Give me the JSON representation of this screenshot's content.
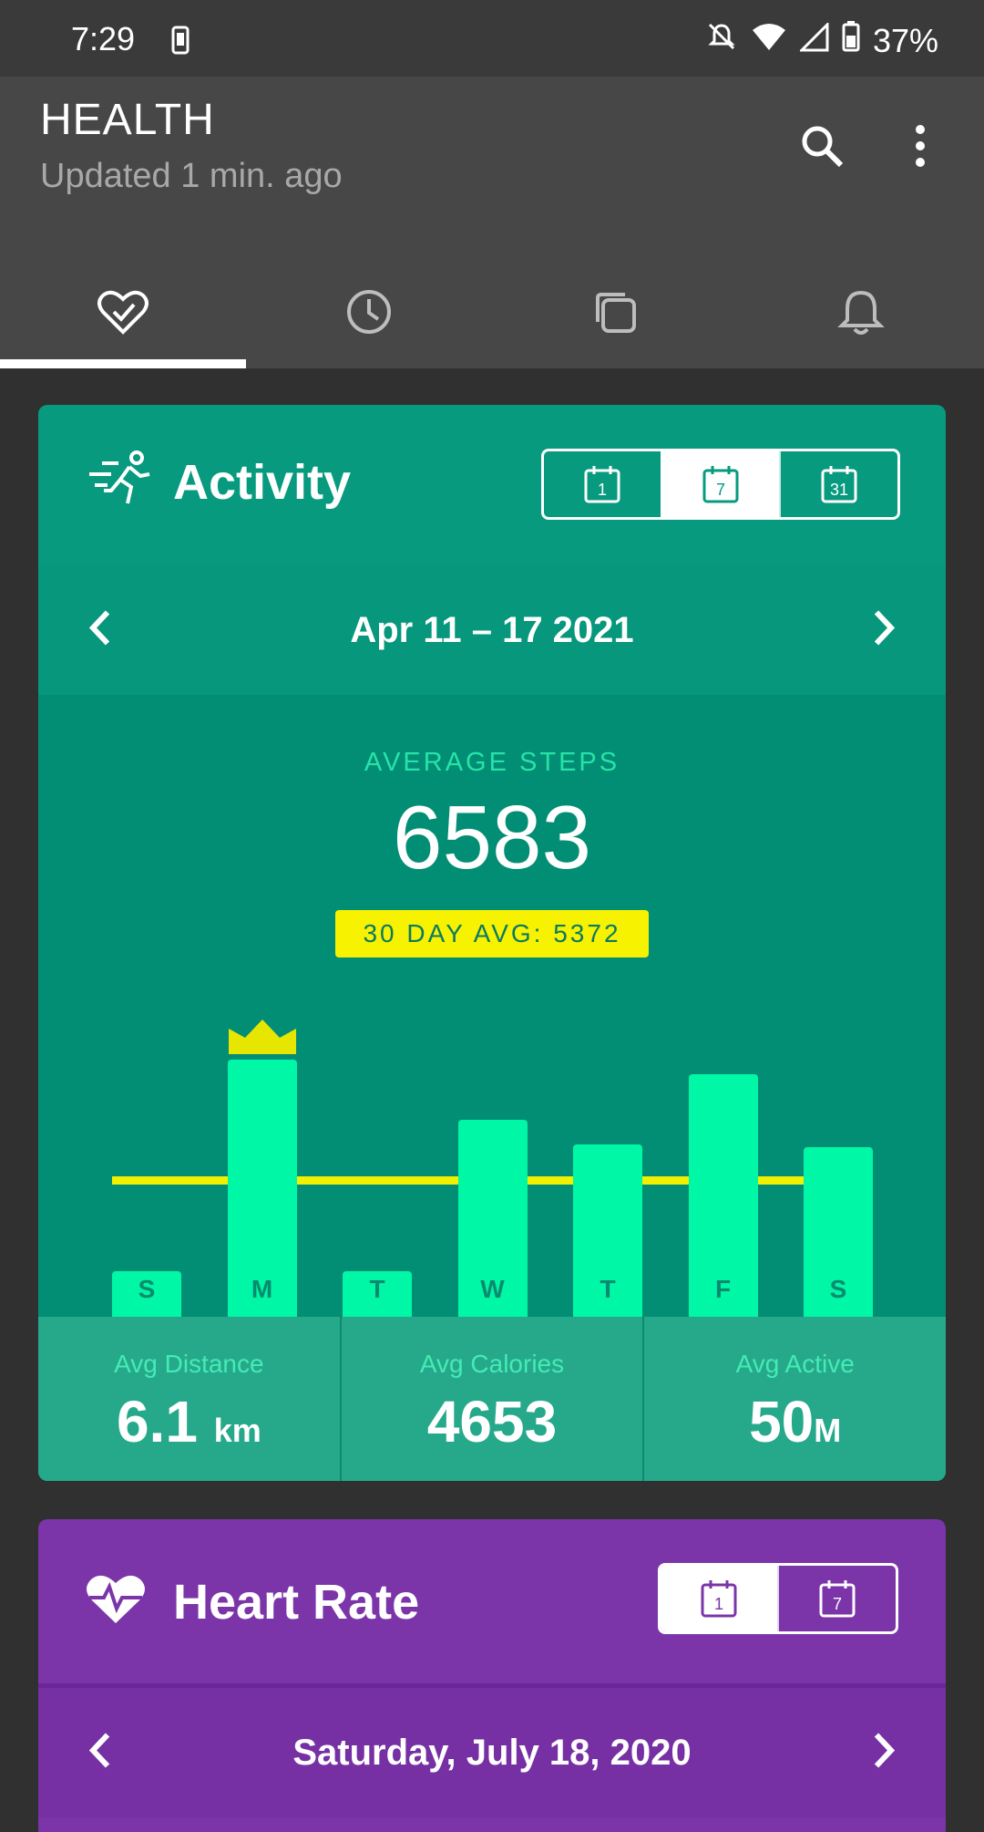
{
  "status": {
    "time": "7:29",
    "battery": "37%"
  },
  "app": {
    "title": "HEALTH",
    "subtitle": "Updated 1 min. ago"
  },
  "tabs": [
    "health",
    "history",
    "pages",
    "alerts"
  ],
  "activity": {
    "title": "Activity",
    "range_options": [
      "1",
      "7",
      "31"
    ],
    "selected_range": "7",
    "date_range": "Apr 11 – 17 2021",
    "avg_steps_label": "AVERAGE STEPS",
    "avg_steps": "6583",
    "thirty_day_avg": "30 DAY AVG: 5372",
    "days": [
      {
        "label": "S",
        "steps": 1200
      },
      {
        "label": "M",
        "steps": 12400
      },
      {
        "label": "T",
        "steps": 1950
      },
      {
        "label": "W",
        "steps": 9500
      },
      {
        "label": "T",
        "steps": 8300
      },
      {
        "label": "F",
        "steps": 11700
      },
      {
        "label": "S",
        "steps": 8200
      }
    ],
    "stats": [
      {
        "label": "Avg Distance",
        "value": "6.1",
        "unit": "km"
      },
      {
        "label": "Avg Calories",
        "value": "4653",
        "unit": ""
      },
      {
        "label": "Avg Active",
        "value": "50",
        "unit": "M"
      }
    ]
  },
  "heart": {
    "title": "Heart Rate",
    "range_options": [
      "1",
      "7"
    ],
    "selected_range": "1",
    "date": "Saturday, July 18, 2020"
  },
  "colors": {
    "activity_bg": "#079a7e",
    "bar": "#00f7a5",
    "avg_line": "#f0f000",
    "heart_bg": "#7b35a8"
  }
}
